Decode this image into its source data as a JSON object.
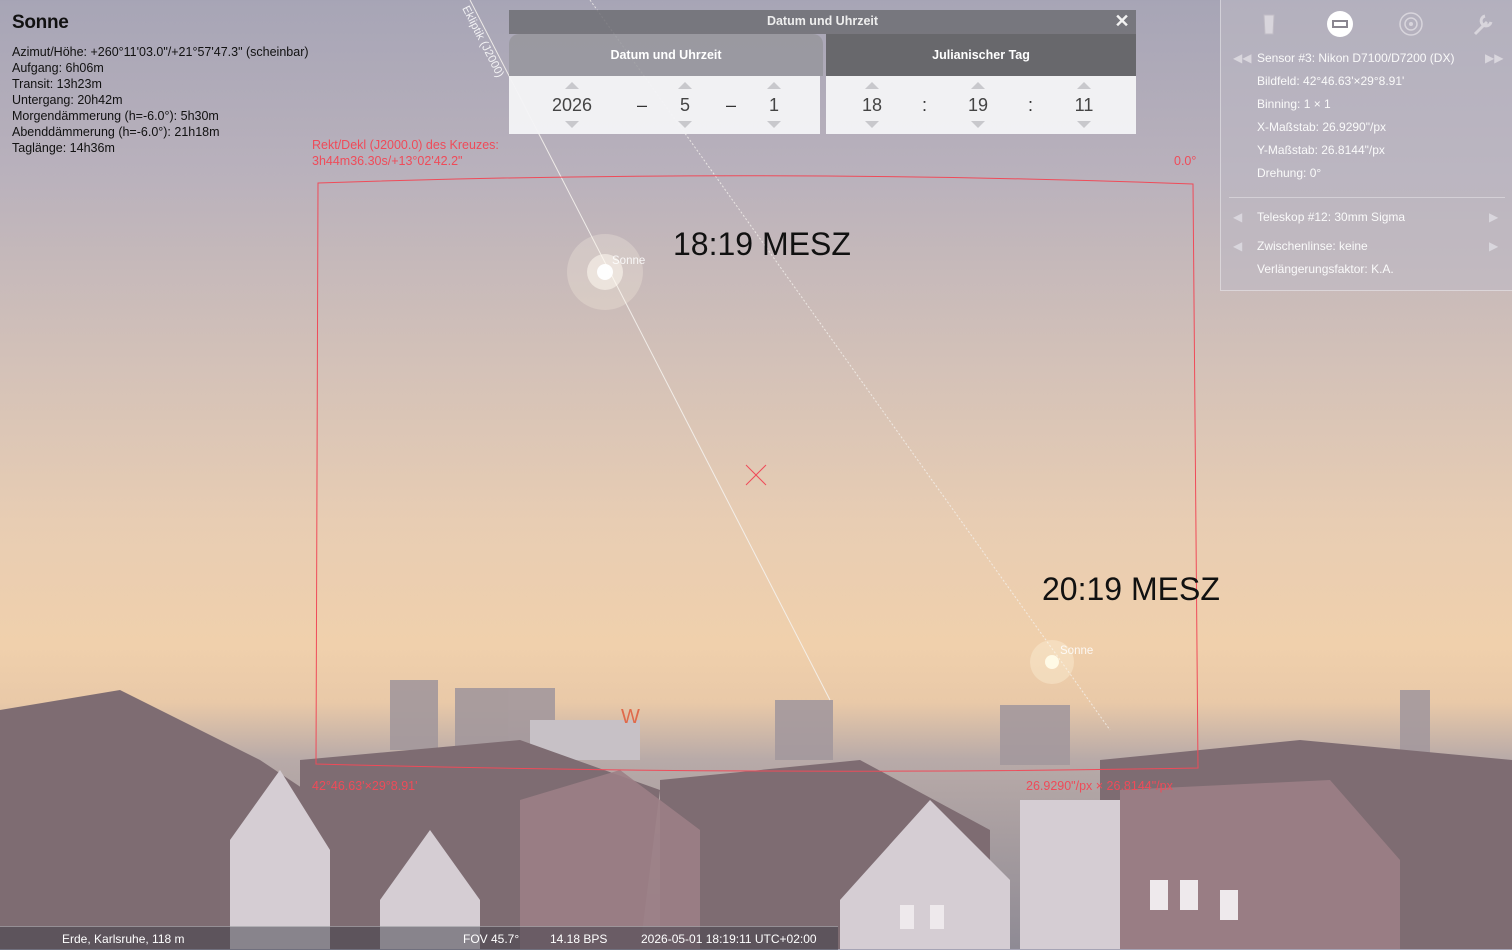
{
  "object": {
    "name": "Sonne",
    "lines": [
      "Azimut/Höhe: +260°11'03.0\"/+21°57'47.3\" (scheinbar)",
      "Aufgang: 6h06m",
      "Transit: 13h23m",
      "Untergang: 20h42m",
      "Morgendämmerung (h=-6.0°): 5h30m",
      "Abenddämmerung (h=-6.0°): 21h18m",
      "Taglänge: 14h36m"
    ]
  },
  "dialog": {
    "title": "Datum und Uhrzeit",
    "close": "✕",
    "tab_date": "Datum und Uhrzeit",
    "tab_jd": "Julianischer Tag",
    "year": "2026",
    "month": "5",
    "day": "1",
    "hour": "18",
    "minute": "19",
    "second": "11",
    "date_sep": "–",
    "time_sep": ":"
  },
  "oculars": {
    "sensor": "Sensor #3: Nikon D7100/D7200 (DX)",
    "field": "Bildfeld: 42°46.63'×29°8.91'",
    "binning": "Binning: 1 × 1",
    "xscale": "X-Maßstab: 26.9290\"/px",
    "yscale": "Y-Maßstab: 26.8144\"/px",
    "rotation": "Drehung: 0°",
    "telescope": "Teleskop #12: 30mm Sigma",
    "lens": "Zwischenlinse: keine",
    "factor": "Verlängerungsfaktor: K.A.",
    "icons": [
      "ocular-icon",
      "sensor-icon",
      "telrad-icon",
      "wrench-icon"
    ]
  },
  "frame": {
    "crosshair_label": "Rekt/Dekl (J2000.0) des Kreuzes:",
    "crosshair_value": "3h44m36.30s/+13°02'42.2\"",
    "rotation": "0.0°",
    "fov": "42°46.63'×29°8.91'",
    "scale": "26.9290\"/px × 26.8144\"/px",
    "color": "#ef4b59"
  },
  "sky": {
    "time1": "18:19 MESZ",
    "time2": "20:19 MESZ",
    "sun_label": "Sonne",
    "ecliptic": "Ekliptik (J2000)",
    "cardinal_w": "W"
  },
  "status": {
    "location": "Erde, Karlsruhe, 118 m",
    "fov": "FOV 45.7°",
    "fps": "14.18 BPS",
    "datetime": "2026-05-01 18:19:11 UTC+02:00"
  }
}
